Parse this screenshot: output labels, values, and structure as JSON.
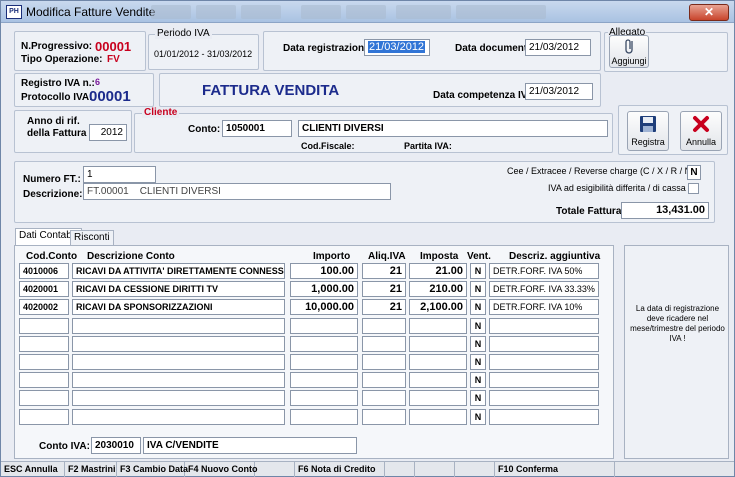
{
  "window": {
    "title": "Modifica Fatture Vendite",
    "app_icon": "PH"
  },
  "header": {
    "progressivo_label": "N.Progressivo:",
    "progressivo_value": "00001",
    "tipo_label": "Tipo Operazione:",
    "tipo_value": "FV",
    "periodo_label": "Periodo IVA",
    "periodo_value": "01/01/2012 - 31/03/2012",
    "data_reg_label": "Data registrazione:",
    "data_reg_value": "21/03/2012",
    "data_doc_label": "Data documento:",
    "data_doc_value": "21/03/2012",
    "allegato_label": "Allegato",
    "aggiungi_label": "Aggiungi",
    "registro_label": "Registro IVA n.:",
    "registro_value": "6",
    "protocollo_label": "Protocollo IVA:",
    "protocollo_value": "00001",
    "doc_title": "FATTURA VENDITA",
    "data_comp_label": "Data competenza IVA:",
    "data_comp_value": "21/03/2012"
  },
  "cliente": {
    "anno_label_1": "Anno di rif.",
    "anno_label_2": "della Fattura",
    "anno_value": "2012",
    "section_label": "Cliente",
    "conto_label": "Conto:",
    "conto_value": "1050001",
    "conto_desc": "CLIENTI DIVERSI",
    "codfiscale_label": "Cod.Fiscale:",
    "piva_label": "Partita IVA:"
  },
  "actions": {
    "registra_label": "Registra",
    "annulla_label": "Annulla"
  },
  "fattura": {
    "numero_label": "Numero FT.:",
    "numero_value": "1",
    "descrizione_label": "Descrizione:",
    "descrizione_value": "FT.00001    CLIENTI DIVERSI",
    "cee_label": "Cee / Extracee / Reverse charge (C / X / R / N",
    "cee_value": "N",
    "iva_diff_label": "IVA ad esigibilità differita / di cassa",
    "totale_label": "Totale Fattura:",
    "totale_value": "13,431.00"
  },
  "tabs": [
    {
      "label": "Dati Contabili"
    },
    {
      "label": "Risconti"
    }
  ],
  "grid": {
    "headers": [
      "Cod.Conto",
      "Descrizione Conto",
      "Importo",
      "Aliq.IVA",
      "Imposta",
      "Vent.",
      "Descriz. aggiuntiva"
    ],
    "rows": [
      {
        "cod": "4010006",
        "desc": "RICAVI DA ATTIVITA' DIRETTAMENTE CONNESS",
        "importo": "100.00",
        "aliq": "21",
        "imposta": "21.00",
        "vent": "N",
        "agg": "DETR.FORF. IVA 50%"
      },
      {
        "cod": "4020001",
        "desc": "RICAVI DA CESSIONE DIRITTI  TV",
        "importo": "1,000.00",
        "aliq": "21",
        "imposta": "210.00",
        "vent": "N",
        "agg": "DETR.FORF. IVA 33.33%"
      },
      {
        "cod": "4020002",
        "desc": "RICAVI DA SPONSORIZZAZIONI",
        "importo": "10,000.00",
        "aliq": "21",
        "imposta": "2,100.00",
        "vent": "N",
        "agg": "DETR.FORF. IVA 10%"
      },
      {
        "vent": "N"
      },
      {
        "vent": "N"
      },
      {
        "vent": "N"
      },
      {
        "vent": "N"
      },
      {
        "vent": "N"
      },
      {
        "vent": "N"
      }
    ],
    "conto_iva_label": "Conto IVA:",
    "conto_iva_value": "2030010",
    "conto_iva_desc": "IVA C/VENDITE"
  },
  "info_message": "La data di registrazione deve ricadere nel mese/trimestre del periodo IVA !",
  "statusbar": [
    "ESC Annulla",
    "F2 Mastrini",
    "F3 Cambio Data",
    "F4 Nuovo Conto",
    "",
    "F6 Nota di Credito",
    "",
    "",
    "",
    "F10 Conferma"
  ],
  "colors": {
    "red": "#c8001e",
    "blue": "#1c2b8c",
    "purple": "#7a1a9a",
    "selection": "#3175d6"
  }
}
